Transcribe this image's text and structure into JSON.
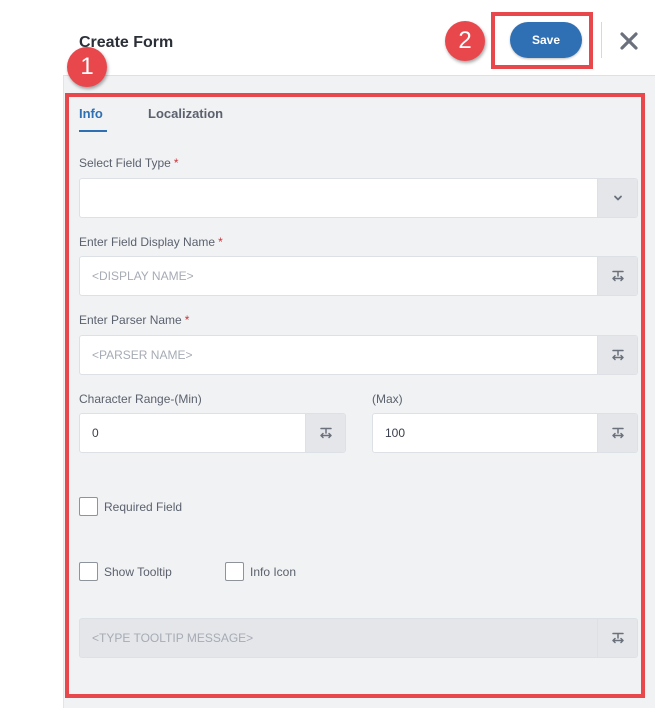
{
  "header": {
    "title": "Create Form",
    "save_label": "Save",
    "close_icon": "close-icon"
  },
  "annotations": {
    "badge1": "1",
    "badge2": "2",
    "highlight_color": "#e8474c"
  },
  "tabs": [
    {
      "label": "Info",
      "active": true
    },
    {
      "label": "Localization",
      "active": false
    }
  ],
  "form": {
    "field_type": {
      "label": "Select Field Type",
      "required_mark": "*",
      "value": ""
    },
    "display_name": {
      "label": "Enter Field Display Name",
      "required_mark": "*",
      "placeholder": "<DISPLAY NAME>"
    },
    "parser_name": {
      "label": "Enter Parser Name",
      "required_mark": "*",
      "placeholder": "<PARSER NAME>"
    },
    "char_min": {
      "label": "Character Range-(Min)",
      "value": "0"
    },
    "char_max": {
      "label": "(Max)",
      "value": "100"
    },
    "required_field": {
      "label": "Required Field",
      "checked": false
    },
    "show_tooltip": {
      "label": "Show Tooltip",
      "checked": false
    },
    "info_icon": {
      "label": "Info Icon",
      "checked": false
    },
    "tooltip_message": {
      "placeholder": "<TYPE TOOLTIP MESSAGE>",
      "disabled": true
    }
  },
  "colors": {
    "accent": "#2f6fb3",
    "required": "#c8353b",
    "panel_bg": "#f1f2f4"
  }
}
